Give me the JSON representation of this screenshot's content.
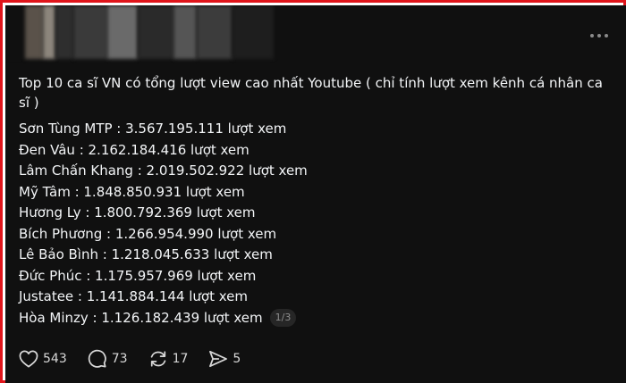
{
  "post": {
    "intro": "Top 10 ca sĩ VN có tổng lượt view cao nhất Youtube ( chỉ tính lượt xem kênh cá nhân ca sĩ )",
    "lines": [
      "Sơn Tùng MTP : 3.567.195.111 lượt xem",
      "Đen Vâu : 2.162.184.416 lượt xem",
      "Lâm Chấn Khang : 2.019.502.922 lượt xem",
      "Mỹ Tâm : 1.848.850.931 lượt xem",
      "Hương Ly : 1.800.792.369 lượt xem",
      "Bích Phương : 1.266.954.990 lượt xem",
      "Lê Bảo Bình : 1.218.045.633 lượt xem",
      "Đức Phúc : 1.175.957.969 lượt xem",
      "Justatee : 1.141.884.144 lượt xem",
      "Hòa Minzy : 1.126.182.439 lượt xem"
    ],
    "page_indicator": "1/3"
  },
  "actions": {
    "likes": "543",
    "comments": "73",
    "reposts": "17",
    "shares": "5"
  },
  "icons": {
    "like": "heart-icon",
    "comment": "comment-icon",
    "repost": "repost-icon",
    "share": "share-icon",
    "more": "more-icon"
  },
  "colors": {
    "frame_border": "#e0151b",
    "background": "#101010",
    "text": "#f3f5f7",
    "muted": "#8e8e8e"
  }
}
